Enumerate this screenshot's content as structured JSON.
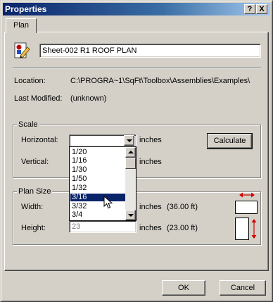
{
  "window": {
    "title": "Properties",
    "help_button": "?",
    "close_button": "X"
  },
  "tabs": [
    {
      "label": "Plan"
    }
  ],
  "plan": {
    "name_value": "Sheet-002 R1 ROOF PLAN",
    "location_label": "Location:",
    "location_value": "C:\\PROGRA~1\\SqFt\\Toolbox\\Assemblies\\Examples\\",
    "modified_label": "Last Modified:",
    "modified_value": "(unknown)"
  },
  "scale": {
    "group_title": "Scale",
    "horizontal_label": "Horizontal:",
    "horizontal_value": "",
    "horizontal_units": "inches",
    "vertical_label": "Vertical:",
    "vertical_units": "inches",
    "calculate_label": "Calculate",
    "dropdown_options": [
      "1/20",
      "1/16",
      "1/30",
      "1/50",
      "1/32",
      "3/16",
      "3/32",
      "3/4"
    ],
    "selected_option": "3/16"
  },
  "plan_size": {
    "group_title": "Plan Size",
    "width_label": "Width:",
    "width_units": "inches",
    "width_feet": "(36.00 ft)",
    "height_label": "Height:",
    "height_value": "23",
    "height_units": "inches",
    "height_feet": "(23.00 ft)"
  },
  "buttons": {
    "ok": "OK",
    "cancel": "Cancel"
  },
  "colors": {
    "accent": "#0a246a",
    "arrow": "#d40000"
  },
  "icons": {
    "sheet": "sheet-pencil-icon",
    "width_arrow": "horizontal-double-arrow-icon",
    "height_arrow": "vertical-double-arrow-icon",
    "cursor": "mouse-pointer-icon"
  }
}
